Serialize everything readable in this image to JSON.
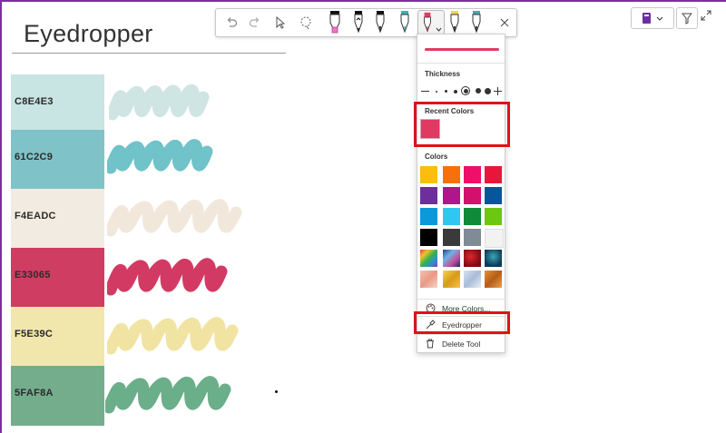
{
  "page": {
    "title": "Eyedropper"
  },
  "swatches": [
    {
      "label": "C8E4E3",
      "color": "#C8E4E3",
      "stroke": "#cfe5e4"
    },
    {
      "label": "61C2C9",
      "color": "#7fc3c8",
      "stroke": "#6fc3c9"
    },
    {
      "label": "F4EADC",
      "color": "#f2ebe1",
      "stroke": "#f1e8db"
    },
    {
      "label": "E33065",
      "color": "#cf3d62",
      "stroke": "#d23a64"
    },
    {
      "label": "F5E39C",
      "color": "#f1e6ac",
      "stroke": "#f1e3a1"
    },
    {
      "label": "5FAF8A",
      "color": "#74ad8c",
      "stroke": "#6aae8a"
    }
  ],
  "toolbar": {
    "icons": [
      "undo-icon",
      "redo-icon",
      "select-pointer-icon",
      "lasso-select-icon",
      "highlighter-pink-icon",
      "pen-black-icon",
      "pen-black-icon",
      "pen-teal-icon",
      "pen-pink-selected-icon",
      "pen-yellow-icon",
      "pen-teal-icon",
      "close-icon"
    ]
  },
  "panel": {
    "thickness_label": "Thickness",
    "recent_colors_label": "Recent Colors",
    "recent_color": "#e03a63",
    "colors_label": "Colors",
    "colors": [
      [
        "#fbbd0e",
        "#f7710b",
        "#ee0f6b",
        "#e8163b"
      ],
      [
        "#6d2f9b",
        "#b1158e",
        "#d3106b",
        "#07569a"
      ],
      [
        "#0b99d9",
        "#30c6f2",
        "#0f8a38",
        "#6cc80f"
      ],
      [
        "#000000",
        "#3a3a3a",
        "#7f8b95",
        "#f2f2f2"
      ]
    ],
    "textures": [
      [
        "texture-rainbow",
        "texture-galaxy",
        "texture-red-nebula",
        "texture-teal-ocean"
      ],
      [
        "texture-rose-gold",
        "texture-gold",
        "texture-silver",
        "texture-bronze"
      ]
    ],
    "more_colors_label": "More Colors...",
    "eyedropper_label": "Eyedropper",
    "delete_tool_label": "Delete Tool"
  },
  "top_right": {
    "icons": [
      "notebook-icon",
      "chevron-down-icon",
      "filter-icon",
      "expand-icon"
    ]
  }
}
